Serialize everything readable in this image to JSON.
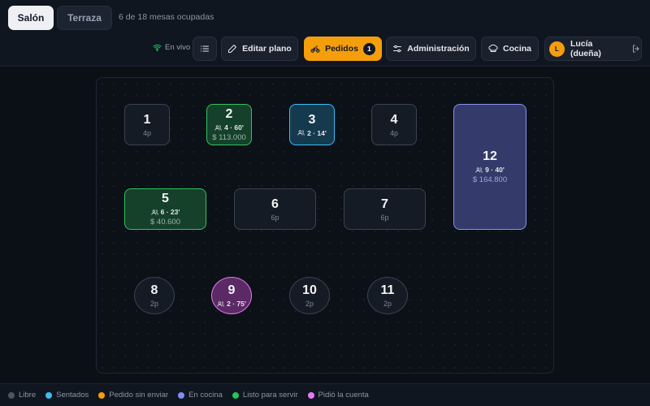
{
  "tabs": [
    {
      "label": "Salón",
      "active": true
    },
    {
      "label": "Terraza",
      "active": false
    }
  ],
  "occupancy_text": "6 de 18 mesas ocupadas",
  "live_label": "En vivo",
  "toolbar": {
    "list_icon": "list-icon",
    "edit_label": "Editar plano",
    "orders_label": "Pedidos",
    "orders_badge": "1",
    "admin_label": "Administración",
    "kitchen_label": "Cocina",
    "user_initial": "L",
    "user_label": "Lucía (dueña)"
  },
  "colors": {
    "accent": "#f59e0b",
    "libre": "#4b5563",
    "sentados": "#38bdf8",
    "pedido_sin_enviar": "#f59e0b",
    "en_cocina": "#818cf8",
    "listo_para_servir": "#22c55e",
    "pidio_la_cuenta": "#e879f9"
  },
  "tables": {
    "t1": {
      "number": "1",
      "capacity": "4p"
    },
    "t2": {
      "number": "2",
      "info": "4 · 60'",
      "amount": "$ 113.000"
    },
    "t3": {
      "number": "3",
      "info": "2 · 14'"
    },
    "t4": {
      "number": "4",
      "capacity": "4p"
    },
    "t5": {
      "number": "5",
      "info": "6 · 23'",
      "amount": "$ 40.600"
    },
    "t6": {
      "number": "6",
      "capacity": "6p"
    },
    "t7": {
      "number": "7",
      "capacity": "6p"
    },
    "t8": {
      "number": "8",
      "capacity": "2p"
    },
    "t9": {
      "number": "9",
      "info": "2 · 75'"
    },
    "t10": {
      "number": "10",
      "capacity": "2p"
    },
    "t11": {
      "number": "11",
      "capacity": "2p"
    },
    "t12": {
      "number": "12",
      "info": "9 · 40'",
      "amount": "$ 164.800"
    }
  },
  "legend": [
    {
      "label": "Libre",
      "color": "#4b5563"
    },
    {
      "label": "Sentados",
      "color": "#38bdf8"
    },
    {
      "label": "Pedido sin enviar",
      "color": "#f59e0b"
    },
    {
      "label": "En cocina",
      "color": "#818cf8"
    },
    {
      "label": "Listo para servir",
      "color": "#22c55e"
    },
    {
      "label": "Pidió la cuenta",
      "color": "#e879f9"
    }
  ]
}
